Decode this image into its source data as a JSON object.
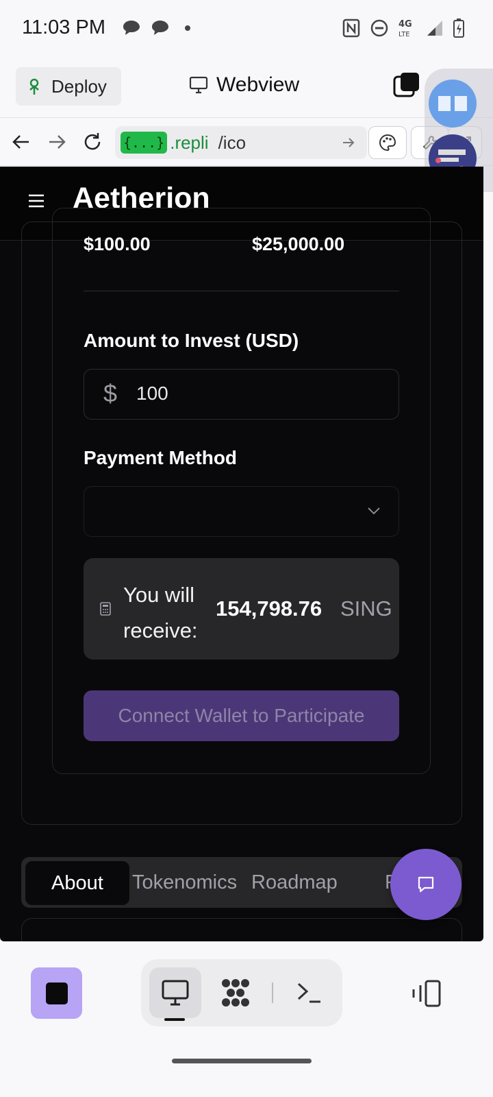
{
  "status_bar": {
    "time": "11:03 PM",
    "network": "4G LTE"
  },
  "toolbar": {
    "deploy_label": "Deploy",
    "webview_title": "Webview"
  },
  "url_bar": {
    "host_badge": "{...}",
    "host": ".repli",
    "path": "/ico"
  },
  "site": {
    "brand": "Aetherion",
    "min_amount": "$100.00",
    "max_amount": "$25,000.00",
    "amount_label": "Amount to Invest (USD)",
    "amount_symbol": "$",
    "amount_value": "100",
    "payment_label": "Payment Method",
    "payment_value": "",
    "receive_label": "You will receive:",
    "receive_amount": "154,798.76",
    "receive_unit": "SING",
    "connect_button": "Connect Wallet to Participate",
    "tabs": [
      "About",
      "Tokenomics",
      "Roadmap",
      "F"
    ]
  },
  "colors": {
    "accent_purple": "#7c5bd0",
    "button_disabled": "#4b3777",
    "replit_green": "#21b84a",
    "stop_button": "#b7a4f5"
  }
}
